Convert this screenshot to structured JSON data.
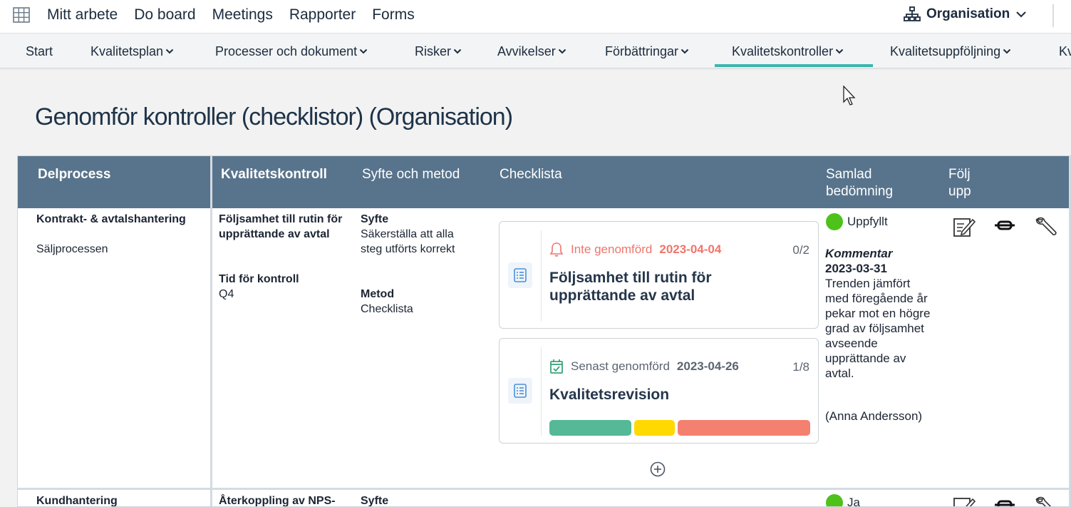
{
  "topnav": {
    "items": [
      "Mitt arbete",
      "Do board",
      "Meetings",
      "Rapporter",
      "Forms"
    ],
    "org_label": "Organisation"
  },
  "subnav": {
    "items": [
      {
        "label": "Start",
        "dropdown": false
      },
      {
        "label": "Kvalitetsplan",
        "dropdown": true
      },
      {
        "label": "Processer och dokument",
        "dropdown": true
      },
      {
        "label": "Risker",
        "dropdown": true
      },
      {
        "label": "Avvikelser",
        "dropdown": true
      },
      {
        "label": "Förbättringar",
        "dropdown": true
      },
      {
        "label": "Kvalitetskontroller",
        "dropdown": true,
        "active": true
      },
      {
        "label": "Kvalitetsuppföljning",
        "dropdown": true
      },
      {
        "label": "Kv",
        "dropdown": false
      }
    ],
    "accent_color": "#3bb6ad"
  },
  "page_title": "Genomför kontroller (checklistor) (Organisation)",
  "table": {
    "headers": {
      "delprocess": "Delprocess",
      "kvalitetskontroll": "Kvalitetskontroll",
      "syfte_metod": "Syfte och metod",
      "checklista": "Checklista",
      "samlad_1": "Samlad",
      "samlad_2": "bedömning",
      "folj_1": "Följ",
      "folj_2": "upp"
    },
    "header_color": "#58748c",
    "row1": {
      "delprocess": "Kontrakt- & avtalshantering",
      "subprocess": "Säljprocessen",
      "kontroll_line1": "Följsamhet till rutin för",
      "kontroll_line2": "upprättande av avtal",
      "tid_label": "Tid för kontroll",
      "tid_value": "Q4",
      "syfte_label": "Syfte",
      "syfte_line1": "Säkerställa att alla",
      "syfte_line2": "steg utförts korrekt",
      "metod_label": "Metod",
      "metod_value": "Checklista",
      "card1": {
        "status_text": "Inte genomförd",
        "date": "2023-04-04",
        "count": "0/2",
        "title_line1": "Följsamhet till rutin för",
        "title_line2": "upprättande av avtal",
        "status_color": "#f0756a"
      },
      "card2": {
        "status_text": "Senast genomförd",
        "date": "2023-04-26",
        "count": "1/8",
        "title": "Kvalitetsrevision",
        "progress": [
          {
            "status": "green",
            "color": "#55b896",
            "fraction": 0.32
          },
          {
            "status": "yellow",
            "color": "#ffd900",
            "fraction": 0.16
          },
          {
            "status": "red",
            "color": "#f4806f",
            "fraction": 0.52
          }
        ]
      },
      "assessment": "Uppfyllt",
      "comment_label": "Kommentar",
      "comment_date": "2023-03-31",
      "comment_lines": [
        "Trenden jämfört",
        "med föregående år",
        "pekar mot en högre",
        "grad av följsamhet",
        "avseende",
        "upprättande av",
        "avtal."
      ],
      "comment_author": "(Anna Andersson)"
    },
    "row2": {
      "delprocess": "Kundhantering",
      "kontroll_line1": "Återkoppling av NPS-",
      "syfte_label": "Syfte",
      "assessment": "Ja"
    }
  }
}
